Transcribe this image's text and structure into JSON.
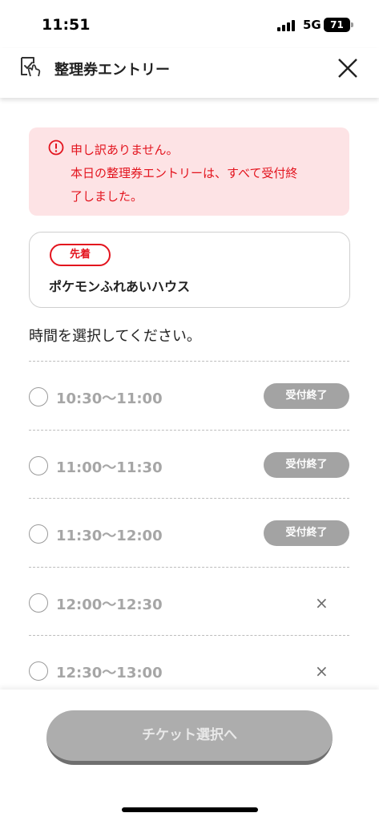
{
  "status_bar": {
    "time": "11:51",
    "network": "5G",
    "battery": "71"
  },
  "header": {
    "title": "整理券エントリー",
    "icon": "ticket-check-icon",
    "close_icon": "close-icon"
  },
  "alert": {
    "icon": "exclamation-circle-icon",
    "lines": [
      "申し訳ありません。",
      "本日の整理券エントリーは、すべて受付終",
      "了しました。"
    ]
  },
  "event": {
    "badge": "先着",
    "name": "ポケモンふれあいハウス"
  },
  "section_heading": "時間を選択してください。",
  "time_slots": [
    {
      "time": "10:30〜11:00",
      "status": "受付終了"
    },
    {
      "time": "11:00〜11:30",
      "status": "受付終了"
    },
    {
      "time": "11:30〜12:00",
      "status": "受付終了"
    },
    {
      "time": "12:00〜12:30",
      "status": "×"
    },
    {
      "time": "12:30〜13:00",
      "status": "×"
    }
  ],
  "ticket_button_label": "チケット選択へ",
  "colors": {
    "accent_red": "#e3141e",
    "alert_bg": "#fde3e5",
    "disabled_gray": "#a3a3a3"
  }
}
